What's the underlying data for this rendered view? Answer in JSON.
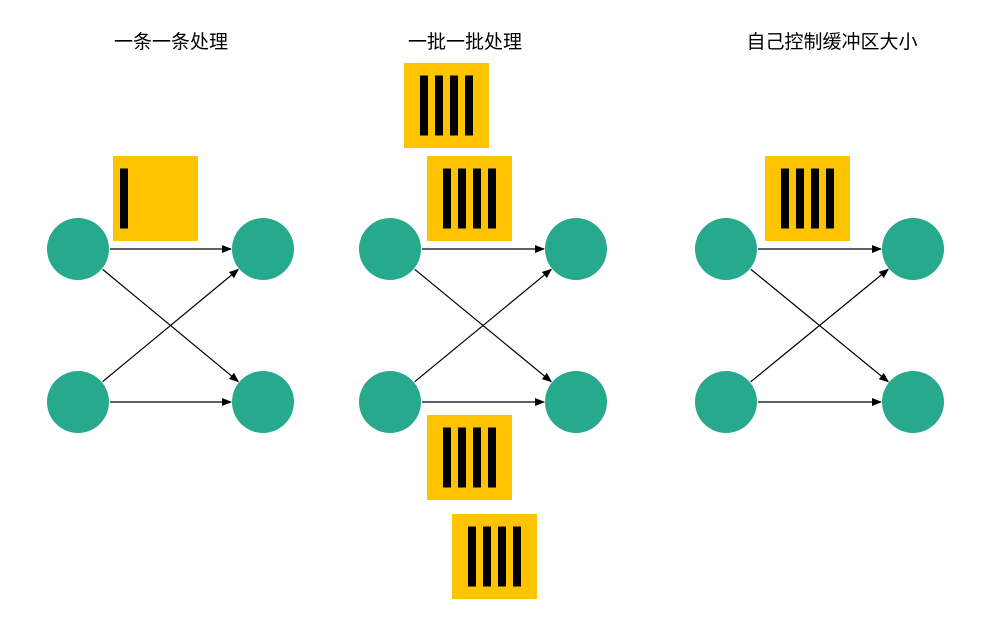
{
  "colors": {
    "node_fill": "#26A98C",
    "packet_fill": "#FFC400",
    "bar_fill": "#000000",
    "edge": "#000000",
    "background": "#FFFFFF"
  },
  "panels": [
    {
      "id": "one-by-one",
      "title": "一条一条处理",
      "packets": [
        {
          "bars": 1
        }
      ]
    },
    {
      "id": "batch-by-batch",
      "title": "一批一批处理",
      "packets": [
        {
          "bars": 4
        },
        {
          "bars": 4
        },
        {
          "bars": 4
        },
        {
          "bars": 4
        }
      ]
    },
    {
      "id": "custom-buffer",
      "title": "自己控制缓冲区大小",
      "packets": [
        {
          "bars": 4
        }
      ]
    }
  ]
}
